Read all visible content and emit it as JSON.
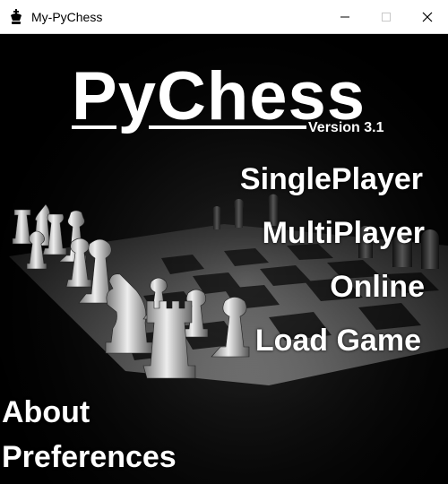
{
  "window": {
    "title": "My-PyChess",
    "app_icon": "king-chess-icon",
    "controls": {
      "minimize": "─",
      "maximize": "☐",
      "close": "✕"
    }
  },
  "main": {
    "logo": "PyChess",
    "version": "Version 3.1",
    "menu": {
      "singleplayer": "SinglePlayer",
      "multiplayer": "MultiPlayer",
      "online": "Online",
      "load_game": "Load Game",
      "about": "About",
      "preferences": "Preferences"
    },
    "background": "chessboard-photo-grayscale"
  },
  "colors": {
    "background": "#000000",
    "text": "#ffffff",
    "titlebar": "#ffffff"
  }
}
